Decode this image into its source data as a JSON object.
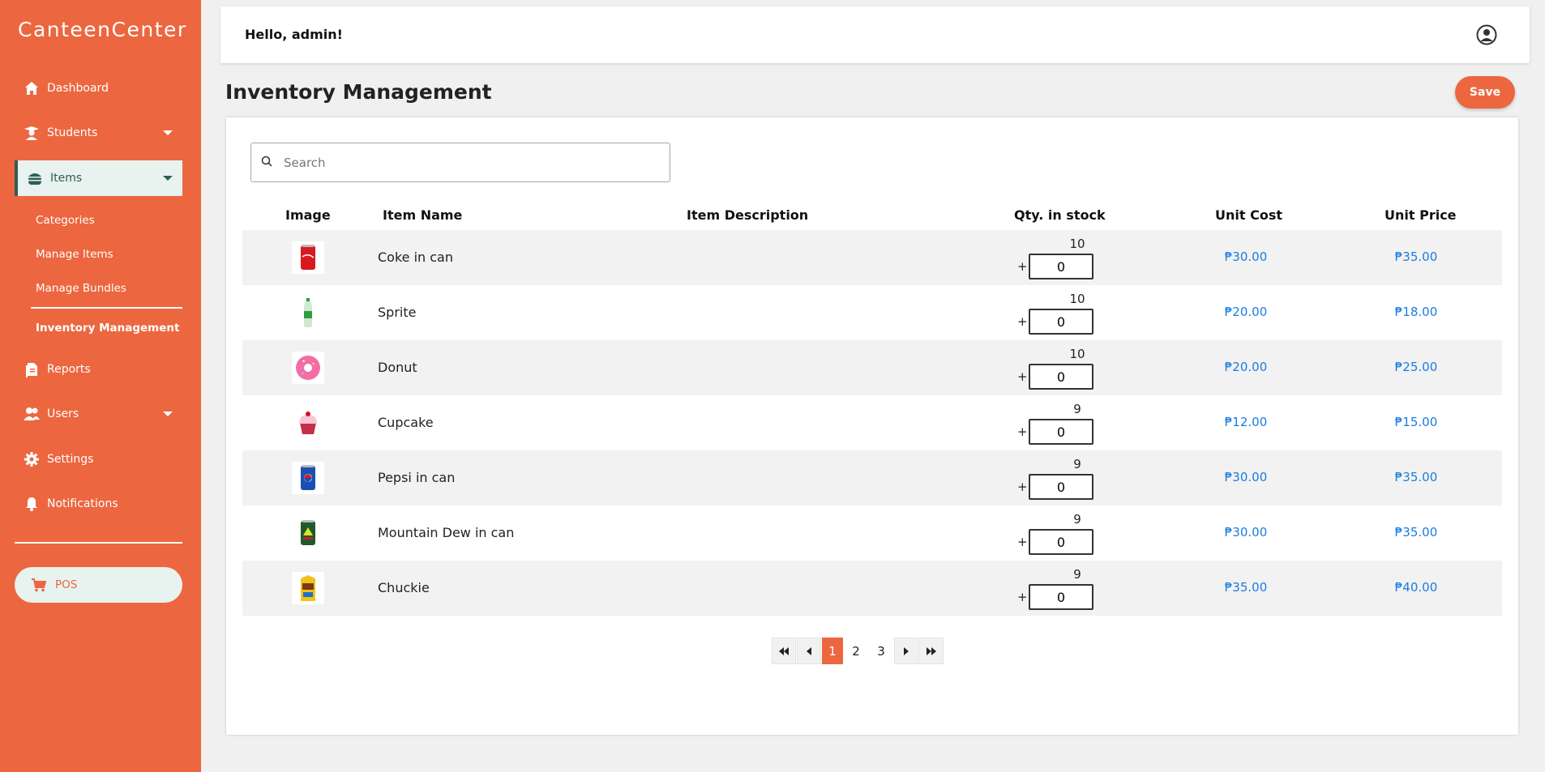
{
  "brand": "CanteenCenter",
  "sidebar": {
    "items": [
      {
        "label": "Dashboard",
        "icon": "home-icon"
      },
      {
        "label": "Students",
        "icon": "student-icon"
      },
      {
        "label": "Items",
        "icon": "burger-icon"
      },
      {
        "label": "Reports",
        "icon": "document-icon"
      },
      {
        "label": "Users",
        "icon": "users-icon"
      },
      {
        "label": "Settings",
        "icon": "gear-icon"
      },
      {
        "label": "Notifications",
        "icon": "bell-icon"
      }
    ],
    "sub_items": [
      "Categories",
      "Manage Items",
      "Manage Bundles",
      "Inventory Management"
    ],
    "pos_label": "POS"
  },
  "header": {
    "greeting": "Hello, admin!"
  },
  "page": {
    "title": "Inventory Management",
    "save_label": "Save"
  },
  "search": {
    "placeholder": "Search"
  },
  "table": {
    "columns": [
      "Image",
      "Item Name",
      "Item Description",
      "Qty. in stock",
      "Unit Cost",
      "Unit Price"
    ],
    "rows": [
      {
        "name": "Coke in can",
        "description": "",
        "qty": "10",
        "add": "0",
        "cost": "₱30.00",
        "price": "₱35.00",
        "image": "red-can"
      },
      {
        "name": "Sprite",
        "description": "",
        "qty": "10",
        "add": "0",
        "cost": "₱20.00",
        "price": "₱18.00",
        "image": "green-bottle"
      },
      {
        "name": "Donut",
        "description": "",
        "qty": "10",
        "add": "0",
        "cost": "₱20.00",
        "price": "₱25.00",
        "image": "pink-donut"
      },
      {
        "name": "Cupcake",
        "description": "",
        "qty": "9",
        "add": "0",
        "cost": "₱12.00",
        "price": "₱15.00",
        "image": "cupcake"
      },
      {
        "name": "Pepsi in can",
        "description": "",
        "qty": "9",
        "add": "0",
        "cost": "₱30.00",
        "price": "₱35.00",
        "image": "blue-can"
      },
      {
        "name": "Mountain Dew in can",
        "description": "",
        "qty": "9",
        "add": "0",
        "cost": "₱30.00",
        "price": "₱35.00",
        "image": "green-can"
      },
      {
        "name": "Chuckie",
        "description": "",
        "qty": "9",
        "add": "0",
        "cost": "₱35.00",
        "price": "₱40.00",
        "image": "yellow-box"
      }
    ]
  },
  "pagination": {
    "pages": [
      "1",
      "2",
      "3"
    ],
    "current": "1"
  },
  "colors": {
    "accent": "#ec6640",
    "active_bg": "#e8f2ef",
    "active_text": "#2e5d57",
    "link": "#1a7de0"
  }
}
